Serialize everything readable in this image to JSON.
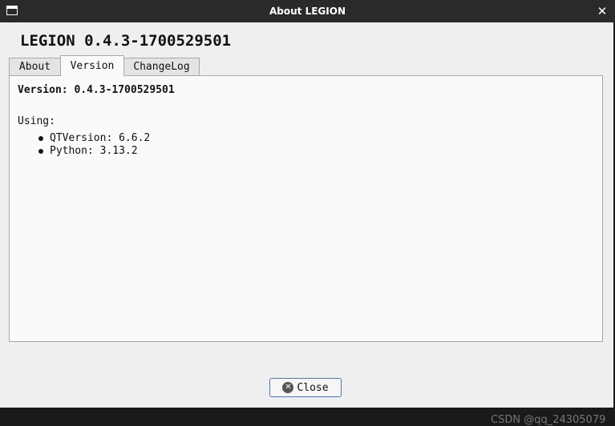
{
  "window": {
    "title": "About LEGION",
    "icon": "window-icon",
    "close_glyph": "✕"
  },
  "app": {
    "heading": "LEGION 0.4.3-1700529501"
  },
  "tabs": [
    {
      "label": "About",
      "active": false
    },
    {
      "label": "Version",
      "active": true
    },
    {
      "label": "ChangeLog",
      "active": false
    }
  ],
  "version_tab": {
    "version_line": "Version: 0.4.3-1700529501",
    "using_label": "Using:",
    "dependencies": [
      "QTVersion: 6.6.2",
      "Python: 3.13.2"
    ]
  },
  "footer": {
    "close_label": "Close",
    "close_icon": "cancel-circle-icon"
  },
  "watermark": "CSDN @qq_24305079",
  "colors": {
    "titlebar": "#2a2a2a",
    "client_bg": "#efefef",
    "panel_bg": "#fafafa",
    "button_border": "#4a78b8"
  }
}
